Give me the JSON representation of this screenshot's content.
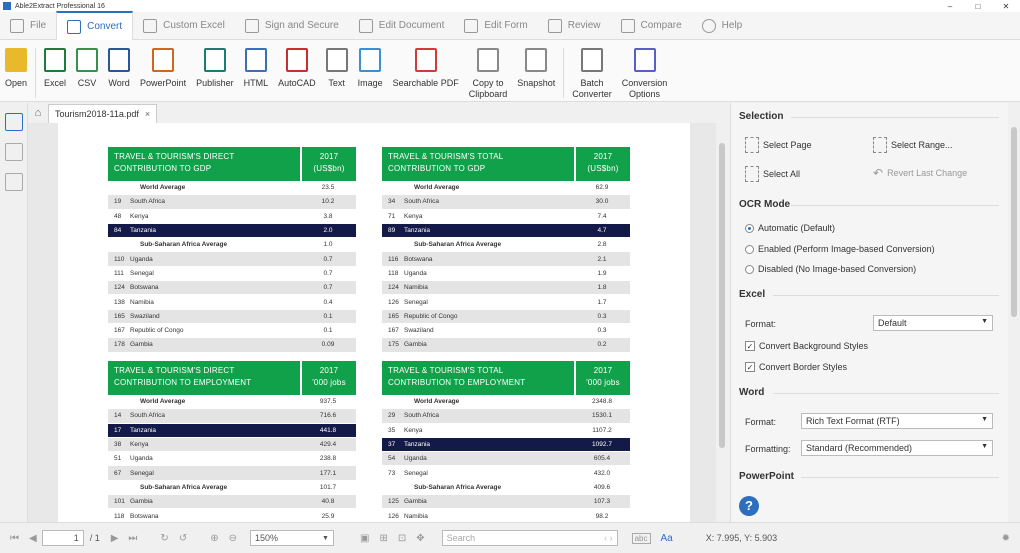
{
  "titlebar": {
    "title": "Able2Extract Professional 16",
    "min": "–",
    "max": "□",
    "close": "✕"
  },
  "tabs": [
    {
      "label": "File",
      "active": false
    },
    {
      "label": "Convert",
      "active": true
    },
    {
      "label": "Custom Excel",
      "active": false
    },
    {
      "label": "Sign and Secure",
      "active": false
    },
    {
      "label": "Edit Document",
      "active": false
    },
    {
      "label": "Edit Form",
      "active": false
    },
    {
      "label": "Review",
      "active": false
    },
    {
      "label": "Compare",
      "active": false
    },
    {
      "label": "Help",
      "active": false
    }
  ],
  "ribbon": [
    {
      "label": "Open",
      "icon": "folder-icon",
      "color": "#e8b92a"
    },
    {
      "label": "Excel",
      "icon": "excel-icon",
      "color": "#1e7b3c"
    },
    {
      "label": "CSV",
      "icon": "csv-icon",
      "color": "#3a8f4a"
    },
    {
      "label": "Word",
      "icon": "word-icon",
      "color": "#2b5797"
    },
    {
      "label": "PowerPoint",
      "icon": "powerpoint-icon",
      "color": "#d0671d"
    },
    {
      "label": "Publisher",
      "icon": "publisher-icon",
      "color": "#1a7c73"
    },
    {
      "label": "HTML",
      "icon": "html-icon",
      "color": "#3b6fb6"
    },
    {
      "label": "AutoCAD",
      "icon": "autocad-icon",
      "color": "#c82e2e"
    },
    {
      "label": "Text",
      "icon": "text-icon",
      "color": "#777777"
    },
    {
      "label": "Image",
      "icon": "image-icon",
      "color": "#3c8fd6"
    },
    {
      "label": "Searchable PDF",
      "icon": "searchable-pdf-icon",
      "color": "#d33b3b"
    },
    {
      "label": "Copy to\nClipboard",
      "icon": "clipboard-icon",
      "color": "#888888"
    },
    {
      "label": "Snapshot",
      "icon": "snapshot-icon",
      "color": "#888888"
    },
    {
      "label": "Batch\nConverter",
      "icon": "batch-converter-icon",
      "color": "#777777"
    },
    {
      "label": "Conversion\nOptions",
      "icon": "gear-icon",
      "color": "#5a5fc7"
    }
  ],
  "doc_tab": {
    "filename": "Tourism2018-11a.pdf",
    "close": "×"
  },
  "tables": [
    {
      "title": "TRAVEL & TOURISM'S DIRECT CONTRIBUTION TO GDP",
      "year": "2017",
      "unit": "(US$bn)",
      "rows": [
        {
          "rank": "",
          "name": "World Average",
          "value": "23.5",
          "style": "bold"
        },
        {
          "rank": "19",
          "name": "South Africa",
          "value": "10.2",
          "style": "g"
        },
        {
          "rank": "48",
          "name": "Kenya",
          "value": "3.8",
          "style": "w"
        },
        {
          "rank": "84",
          "name": "Tanzania",
          "value": "2.0",
          "style": "h"
        },
        {
          "rank": "",
          "name": "Sub-Saharan Africa Average",
          "value": "1.0",
          "style": "bold"
        },
        {
          "rank": "110",
          "name": "Uganda",
          "value": "0.7",
          "style": "g"
        },
        {
          "rank": "111",
          "name": "Senegal",
          "value": "0.7",
          "style": "w"
        },
        {
          "rank": "124",
          "name": "Botswana",
          "value": "0.7",
          "style": "g"
        },
        {
          "rank": "138",
          "name": "Namibia",
          "value": "0.4",
          "style": "w"
        },
        {
          "rank": "165",
          "name": "Swaziland",
          "value": "0.1",
          "style": "g"
        },
        {
          "rank": "167",
          "name": "Republic of Congo",
          "value": "0.1",
          "style": "w"
        },
        {
          "rank": "178",
          "name": "Gambia",
          "value": "0.09",
          "style": "g"
        }
      ]
    },
    {
      "title": "TRAVEL & TOURISM'S TOTAL CONTRIBUTION TO GDP",
      "year": "2017",
      "unit": "(US$bn)",
      "rows": [
        {
          "rank": "",
          "name": "World Average",
          "value": "62.9",
          "style": "bold"
        },
        {
          "rank": "34",
          "name": "South Africa",
          "value": "30.0",
          "style": "g"
        },
        {
          "rank": "71",
          "name": "Kenya",
          "value": "7.4",
          "style": "w"
        },
        {
          "rank": "89",
          "name": "Tanzania",
          "value": "4.7",
          "style": "h"
        },
        {
          "rank": "",
          "name": "Sub-Saharan Africa Average",
          "value": "2.8",
          "style": "bold"
        },
        {
          "rank": "116",
          "name": "Botswana",
          "value": "2.1",
          "style": "g"
        },
        {
          "rank": "118",
          "name": "Uganda",
          "value": "1.9",
          "style": "w"
        },
        {
          "rank": "124",
          "name": "Namibia",
          "value": "1.8",
          "style": "g"
        },
        {
          "rank": "126",
          "name": "Senegal",
          "value": "1.7",
          "style": "w"
        },
        {
          "rank": "165",
          "name": "Republic of Congo",
          "value": "0.3",
          "style": "g"
        },
        {
          "rank": "167",
          "name": "Swaziland",
          "value": "0.3",
          "style": "w"
        },
        {
          "rank": "175",
          "name": "Gambia",
          "value": "0.2",
          "style": "g"
        }
      ]
    },
    {
      "title": "TRAVEL & TOURISM'S DIRECT CONTRIBUTION TO EMPLOYMENT",
      "year": "2017",
      "unit": "'000 jobs",
      "rows": [
        {
          "rank": "",
          "name": "World Average",
          "value": "937.5",
          "style": "bold"
        },
        {
          "rank": "14",
          "name": "South Africa",
          "value": "716.6",
          "style": "g"
        },
        {
          "rank": "17",
          "name": "Tanzania",
          "value": "441.8",
          "style": "h"
        },
        {
          "rank": "38",
          "name": "Kenya",
          "value": "429.4",
          "style": "g"
        },
        {
          "rank": "51",
          "name": "Uganda",
          "value": "238.8",
          "style": "w"
        },
        {
          "rank": "67",
          "name": "Senegal",
          "value": "177.1",
          "style": "g"
        },
        {
          "rank": "",
          "name": "Sub-Saharan Africa Average",
          "value": "101.7",
          "style": "bold"
        },
        {
          "rank": "101",
          "name": "Gambia",
          "value": "40.8",
          "style": "g"
        },
        {
          "rank": "118",
          "name": "Botswana",
          "value": "25.9",
          "style": "w"
        }
      ]
    },
    {
      "title": "TRAVEL & TOURISM'S TOTAL CONTRIBUTION TO EMPLOYMENT",
      "year": "2017",
      "unit": "'000 jobs",
      "rows": [
        {
          "rank": "",
          "name": "World Average",
          "value": "2348.8",
          "style": "bold"
        },
        {
          "rank": "29",
          "name": "South Africa",
          "value": "1530.1",
          "style": "g"
        },
        {
          "rank": "35",
          "name": "Kenya",
          "value": "1107.2",
          "style": "w"
        },
        {
          "rank": "37",
          "name": "Tanzania",
          "value": "1092.7",
          "style": "h"
        },
        {
          "rank": "54",
          "name": "Uganda",
          "value": "605.4",
          "style": "g"
        },
        {
          "rank": "73",
          "name": "Senegal",
          "value": "432.0",
          "style": "w"
        },
        {
          "rank": "",
          "name": "Sub-Saharan Africa Average",
          "value": "409.6",
          "style": "bold"
        },
        {
          "rank": "125",
          "name": "Gambia",
          "value": "107.3",
          "style": "g"
        },
        {
          "rank": "126",
          "name": "Namibia",
          "value": "98.2",
          "style": "w"
        }
      ]
    }
  ],
  "panel": {
    "selection": {
      "title": "Selection",
      "select_page": "Select Page",
      "select_range": "Select Range...",
      "select_all": "Select All",
      "revert": "Revert Last Change"
    },
    "ocr": {
      "title": "OCR Mode",
      "options": [
        {
          "label": "Automatic (Default)",
          "selected": true
        },
        {
          "label": "Enabled (Perform Image-based Conversion)",
          "selected": false
        },
        {
          "label": "Disabled (No Image-based Conversion)",
          "selected": false
        }
      ]
    },
    "excel": {
      "title": "Excel",
      "format_label": "Format:",
      "format_value": "Default",
      "convert_bg": "Convert Background Styles",
      "convert_border": "Convert Border Styles",
      "bg_checked": "✓",
      "border_checked": "✓"
    },
    "word": {
      "title": "Word",
      "format_label": "Format:",
      "format_value": "Rich Text Format (RTF)",
      "formatting_label": "Formatting:",
      "formatting_value": "Standard (Recommended)"
    },
    "powerpoint": {
      "title": "PowerPoint"
    },
    "help": "?"
  },
  "status": {
    "page_current": "1",
    "page_total": "/ 1",
    "zoom": "150%",
    "search_placeholder": "Search",
    "match_case": "abc",
    "font_toggle": "Aa",
    "coords": "X: 7.995, Y: 5.903"
  }
}
